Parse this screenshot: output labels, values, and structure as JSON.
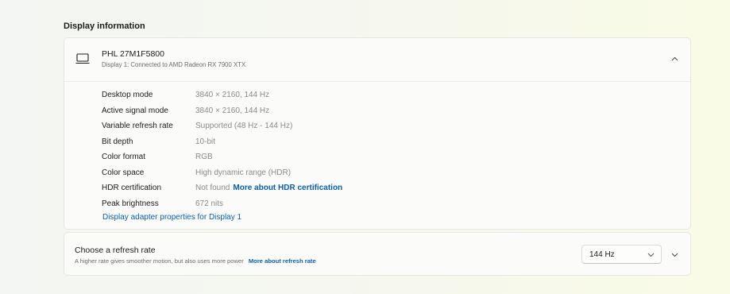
{
  "section": {
    "title": "Display information"
  },
  "display": {
    "name": "PHL 27M1F5800",
    "subtitle": "Display 1: Connected to AMD Radeon RX 7900 XTX",
    "icon": "monitor-icon",
    "collapse_icon": "chevron-up-icon",
    "info": [
      {
        "label": "Desktop mode",
        "value": "3840 × 2160, 144 Hz"
      },
      {
        "label": "Active signal mode",
        "value": "3840 × 2160, 144 Hz"
      },
      {
        "label": "Variable refresh rate",
        "value": "Supported (48 Hz - 144 Hz)"
      },
      {
        "label": "Bit depth",
        "value": "10-bit"
      },
      {
        "label": "Color format",
        "value": "RGB"
      },
      {
        "label": "Color space",
        "value": "High dynamic range (HDR)"
      },
      {
        "label": "HDR certification",
        "value": "Not found",
        "link": "More about HDR certification"
      },
      {
        "label": "Peak brightness",
        "value": "672 nits"
      }
    ],
    "adapter_link": "Display adapter properties for Display 1"
  },
  "refresh": {
    "title": "Choose a refresh rate",
    "subtitle": "A higher rate gives smoother motion, but also uses more power",
    "link": "More about refresh rate",
    "selected_rate": "144 Hz",
    "dropdown_icon": "chevron-down-icon",
    "expand_icon": "chevron-down-icon"
  },
  "colors": {
    "link": "#0a5fb0",
    "label": "#1b1b1b",
    "value": "#8a8a8a",
    "card_bg": "#fbfbfa"
  }
}
